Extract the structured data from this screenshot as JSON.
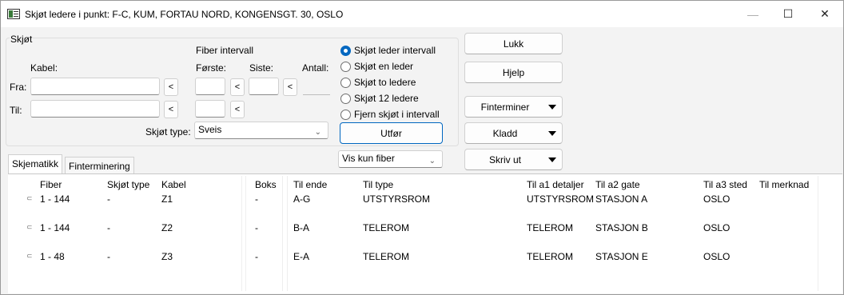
{
  "window": {
    "title": "Skjøt ledere i punkt: F-C, KUM, FORTAU NORD, KONGENSGT. 30, OSLO",
    "minimize_glyph": "—",
    "maximize_glyph": "☐",
    "close_glyph": "✕"
  },
  "form": {
    "group_label": "Skjøt",
    "kabel_label": "Kabel:",
    "fra_label": "Fra:",
    "til_label": "Til:",
    "fra_value": "",
    "til_value": "",
    "fiber_interval_label": "Fiber intervall",
    "forste_label": "Første:",
    "siste_label": "Siste:",
    "antall_label": "Antall:",
    "less_glyph": "<",
    "skjot_type_label": "Skjøt type:",
    "skjot_type_value": "Sveis"
  },
  "options": {
    "items": [
      {
        "label": "Skjøt leder intervall",
        "selected": true
      },
      {
        "label": "Skjøt en leder",
        "selected": false
      },
      {
        "label": "Skjøt to ledere",
        "selected": false
      },
      {
        "label": "Skjøt 12 ledere",
        "selected": false
      },
      {
        "label": "Fjern skjøt i intervall",
        "selected": false
      }
    ],
    "execute_label": "Utfør",
    "view_filter_value": "Vis kun fiber"
  },
  "actions": {
    "close_label": "Lukk",
    "help_label": "Hjelp",
    "finterminer_label": "Finterminer",
    "kladd_label": "Kladd",
    "print_label": "Skriv ut"
  },
  "tabs": [
    {
      "label": "Skjematikk",
      "active": true
    },
    {
      "label": "Finterminering",
      "active": false
    }
  ],
  "table": {
    "columns": [
      "Fiber",
      "Skjøt type",
      "Kabel",
      "Boks",
      "Til ende",
      "Til type",
      "Til a1 detaljer",
      "Til a2 gate",
      "Til a3 sted",
      "Til merknad"
    ],
    "rows": [
      [
        "1 - 144",
        "-",
        "Z1",
        "-",
        "A-G",
        "UTSTYRSROM",
        "UTSTYRSROM",
        "STASJON A",
        "OSLO",
        ""
      ],
      [
        "1 - 144",
        "-",
        "Z2",
        "-",
        "B-A",
        "TELEROM",
        "TELEROM",
        "STASJON B",
        "OSLO",
        ""
      ],
      [
        "1 - 48",
        "-",
        "Z3",
        "-",
        "E-A",
        "TELEROM",
        "TELEROM",
        "STASJON E",
        "OSLO",
        ""
      ]
    ]
  },
  "colors": {
    "accent": "#0067c0",
    "window_bg": "#f3f3f3",
    "table_bg": "#ffffff"
  }
}
